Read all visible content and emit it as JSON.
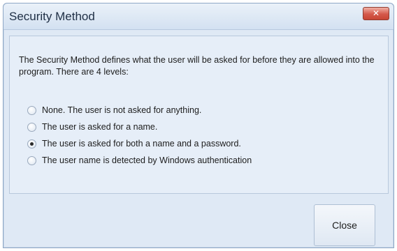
{
  "window": {
    "title": "Security Method",
    "close_glyph": "✕"
  },
  "description": "The Security Method defines what the user will be asked for before they are allowed into the program. There are 4 levels:",
  "options": [
    {
      "label": "None. The user is not asked for anything.",
      "checked": false
    },
    {
      "label": "The user is asked for a name.",
      "checked": false
    },
    {
      "label": "The user is asked for both a name and a password.",
      "checked": true
    },
    {
      "label": "The user name is detected by Windows authentication",
      "checked": false
    }
  ],
  "buttons": {
    "close_label": "Close"
  }
}
